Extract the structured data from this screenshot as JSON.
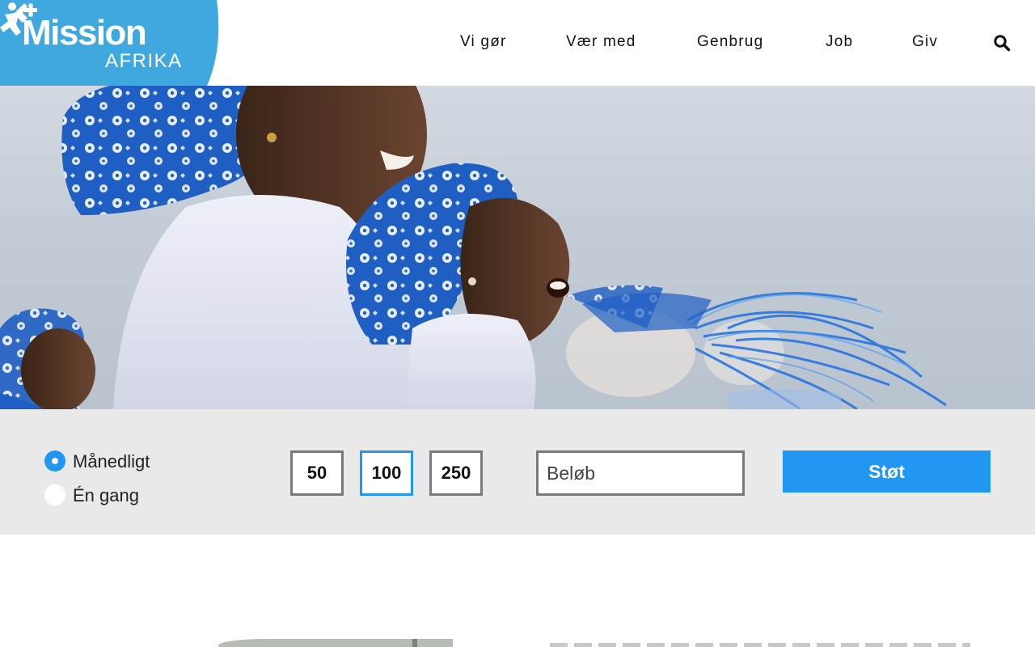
{
  "logo": {
    "main": "Mission",
    "sub": "AFRIKA",
    "color": "#3fa9df"
  },
  "nav": {
    "items": [
      {
        "label": "Vi gør"
      },
      {
        "label": "Vær med"
      },
      {
        "label": "Genbrug"
      },
      {
        "label": "Job"
      },
      {
        "label": "Giv"
      }
    ],
    "search_icon": "search-icon"
  },
  "hero": {
    "description_icon": "hero-photo"
  },
  "donation": {
    "frequency": [
      {
        "label": "Månedligt",
        "checked": true
      },
      {
        "label": "Én gang",
        "checked": false
      }
    ],
    "amounts": [
      {
        "value": "50",
        "selected": false
      },
      {
        "value": "100",
        "selected": true
      },
      {
        "value": "250",
        "selected": false
      }
    ],
    "custom_amount": {
      "placeholder": "Beløb",
      "value": ""
    },
    "submit_label": "Støt",
    "accent": "#2196f3"
  }
}
